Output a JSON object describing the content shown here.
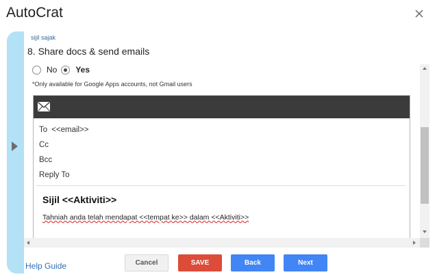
{
  "app": {
    "title": "AutoCrat"
  },
  "step": {
    "subtitle": "sijil sajak",
    "title": "8. Share docs & send emails"
  },
  "radio": {
    "no_label": "No",
    "yes_label": "Yes",
    "selected": "Yes"
  },
  "note": "*Only available for Google Apps accounts, not Gmail users",
  "email": {
    "to_label": "To",
    "to_value": "<<email>>",
    "cc_label": "Cc",
    "bcc_label": "Bcc",
    "reply_to_label": "Reply To",
    "subject": "Sijil <<Aktiviti>>",
    "body": "Tahniah anda telah mendapat <<tempat ke>> dalam <<Aktiviti>>"
  },
  "footer": {
    "help_label": "Help Guide",
    "cancel_label": "Cancel",
    "save_label": "SAVE",
    "back_label": "Back",
    "next_label": "Next"
  },
  "icons": {
    "close": "close-icon",
    "mail": "mail-icon",
    "expand": "chevron-right-icon"
  },
  "colors": {
    "rail": "#b3e1f6",
    "save": "#dd4b39",
    "primary": "#4285f4",
    "header": "#3b3b3b",
    "link": "#2f6fb2"
  }
}
